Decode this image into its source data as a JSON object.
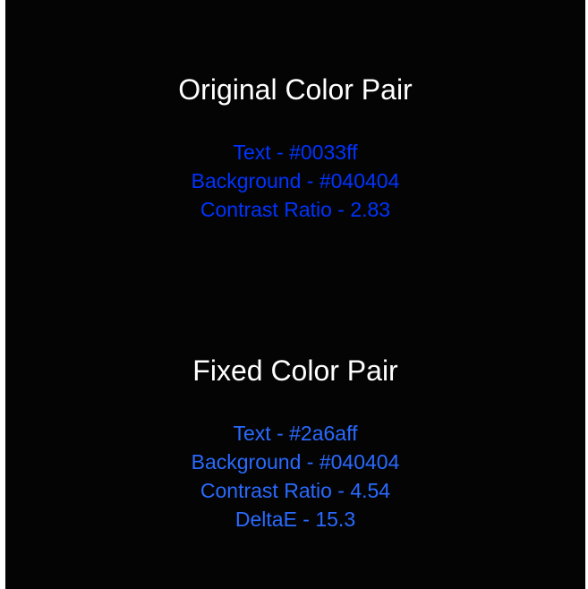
{
  "colors": {
    "page_background": "#040404",
    "title_color": "#ffffff",
    "original_text_color": "#0033ff",
    "fixed_text_color": "#2a6aff"
  },
  "original": {
    "title": "Original Color Pair",
    "text": "Text - #0033ff",
    "background": "Background - #040404",
    "contrast": "Contrast Ratio - 2.83"
  },
  "fixed": {
    "title": "Fixed Color Pair",
    "text": "Text - #2a6aff",
    "background": "Background - #040404",
    "contrast": "Contrast Ratio - 4.54",
    "delta": "DeltaE - 15.3"
  }
}
